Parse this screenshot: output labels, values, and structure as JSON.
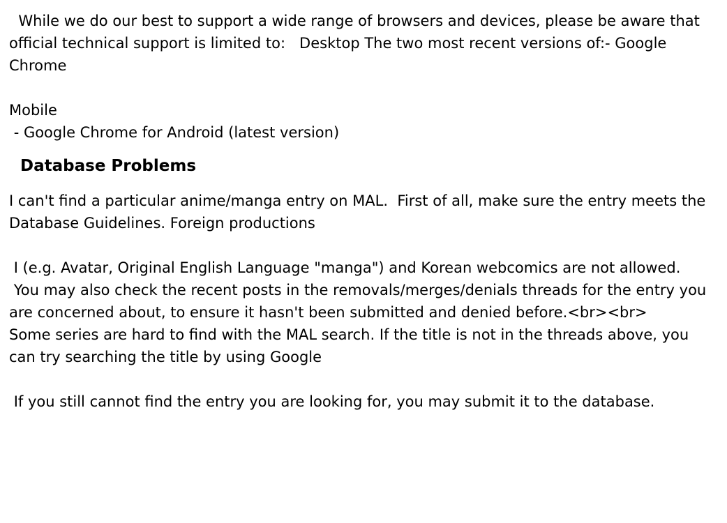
{
  "support": {
    "intro": "  While we do our best to support a wide range of browsers and devices, please be aware that official technical support is limited to:   Desktop The two most recent versions of:- Google Chrome",
    "mobile_label": "Mobile",
    "mobile_item": " - Google Chrome for Android (latest version)"
  },
  "database": {
    "heading": "  Database Problems",
    "question": "I can't find a particular anime/manga entry on MAL.  First of all, make sure the entry meets the Database Guidelines. Foreign productions",
    "guidelines_line": " I (e.g. Avatar, Original English Language \"manga\") and Korean webcomics are not allowed.",
    "removals_line": " You may also check the recent posts in the removals/merges/denials threads for the entry you are concerned about, to ensure it hasn't been submitted and denied before.<br><br>",
    "search_line": "Some series are hard to find with the MAL search. If the title is not in the threads above, you can try searching the title by using Google",
    "submit_line": " If you still cannot find the entry you are looking for, you may submit it to the database."
  }
}
